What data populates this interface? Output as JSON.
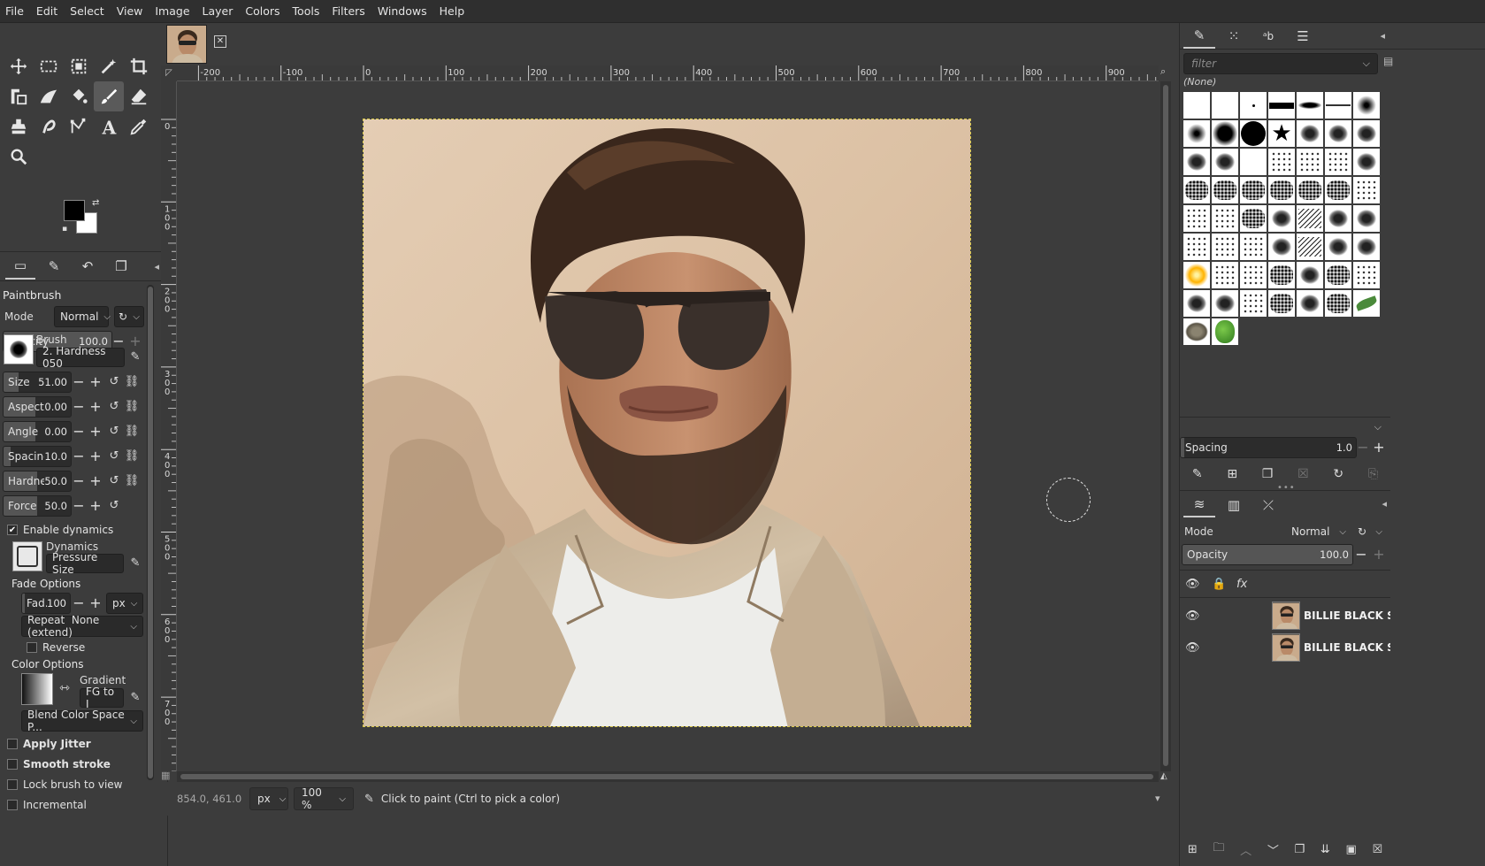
{
  "menubar": [
    "File",
    "Edit",
    "Select",
    "View",
    "Image",
    "Layer",
    "Colors",
    "Tools",
    "Filters",
    "Windows",
    "Help"
  ],
  "tool_options": {
    "title": "Paintbrush",
    "mode_label": "Mode",
    "mode_value": "Normal",
    "opacity_label": "Opacity",
    "opacity_value": "100.0",
    "brush_label": "Brush",
    "brush_value": "2. Hardness 050",
    "size_label": "Size",
    "size_value": "51.00",
    "aspect_label": "Aspect ...",
    "aspect_value": "0.00",
    "angle_label": "Angle",
    "angle_value": "0.00",
    "spacing_label": "Spacing",
    "spacing_value": "10.0",
    "hardness_label": "Hardness",
    "hardness_value": "50.0",
    "force_label": "Force",
    "force_value": "50.0",
    "enable_dynamics": "Enable dynamics",
    "dynamics_label": "Dynamics",
    "dynamics_value": "Pressure Size",
    "fade_options": "Fade Options",
    "fade_label": "Fad...",
    "fade_value": "100",
    "fade_unit": "px",
    "repeat_label": "Repeat",
    "repeat_value": "None (extend)",
    "reverse": "Reverse",
    "color_options": "Color Options",
    "gradient_label": "Gradient",
    "gradient_value": "FG to I",
    "blend_space": "Blend Color Space P...",
    "apply_jitter": "Apply Jitter",
    "smooth_stroke": "Smooth stroke",
    "lock_brush": "Lock brush to view",
    "incremental": "Incremental"
  },
  "rulers": {
    "h_ticks": [
      "-200",
      "-100",
      "0",
      "100",
      "200",
      "300",
      "400",
      "500",
      "600",
      "700",
      "800",
      "900"
    ],
    "v_ticks": [
      "0",
      "100",
      "200",
      "300",
      "400",
      "500",
      "600",
      "700"
    ]
  },
  "statusbar": {
    "coords": "854.0, 461.0",
    "unit": "px",
    "zoom": "100 %",
    "message": "Click to paint (Ctrl to pick a color)"
  },
  "brushes_panel": {
    "filter_placeholder": "filter",
    "selected": "(None)",
    "spacing_label": "Spacing",
    "spacing_value": "1.0"
  },
  "layers_panel": {
    "mode_label": "Mode",
    "mode_value": "Normal",
    "opacity_label": "Opacity",
    "opacity_value": "100.0",
    "layers": [
      {
        "name": "BILLIE BLACK SMOKE"
      },
      {
        "name": "BILLIE BLACK SMOKE"
      }
    ]
  },
  "colors": {
    "foreground": "#000000",
    "background": "#ffffff",
    "selection": "#d8c84a"
  }
}
